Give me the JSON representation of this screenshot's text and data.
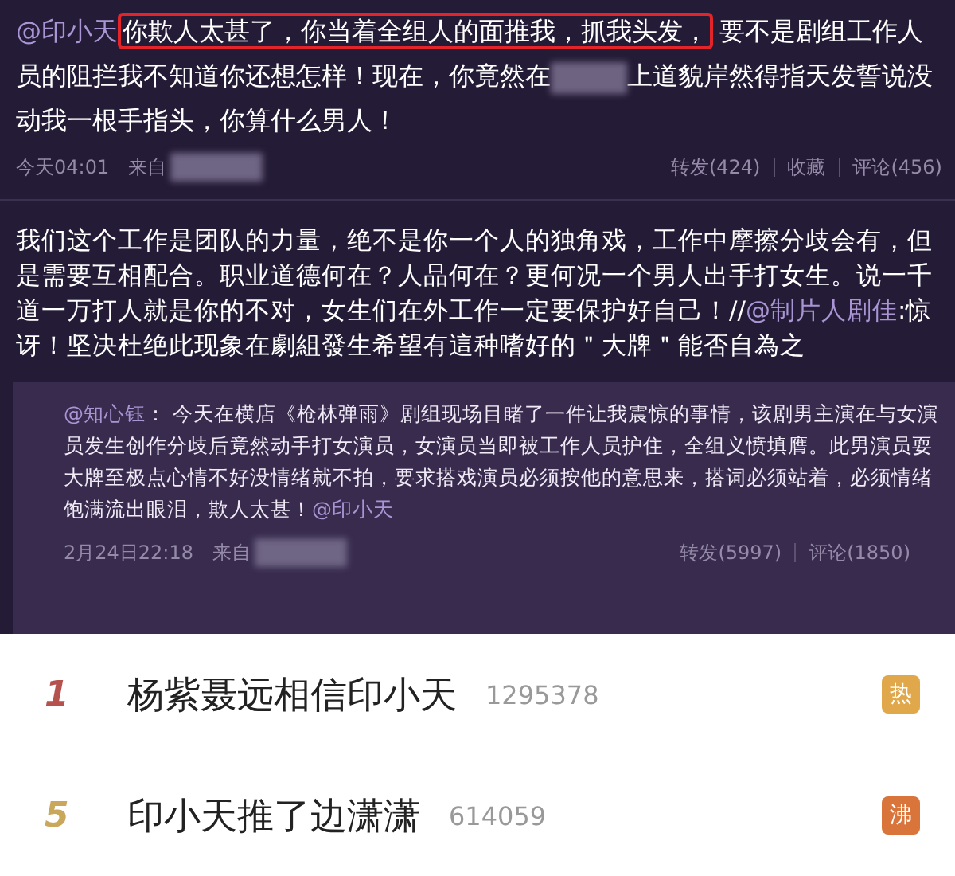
{
  "post": {
    "parts": [
      {
        "kind": "mention",
        "text": "@印小天"
      },
      {
        "kind": "highlight",
        "text": "你欺人太甚了，你当着全组人的面推我，抓我头发，"
      },
      {
        "kind": "text",
        "text": "要不是剧组工作人员的阻拦我不知道你还想怎样！现在，你竟然在"
      },
      {
        "kind": "redacted"
      },
      {
        "kind": "text",
        "text": "上道貌岸然得指天发誓说没动我一根手指头，你算什么男人！"
      }
    ],
    "time": "今天04:01",
    "source": "来自",
    "actions": [
      "转发(424)",
      "收藏",
      "评论(456)"
    ]
  },
  "repost": {
    "parts": [
      {
        "kind": "text",
        "text": "我们这个工作是团队的力量，绝不是你一个人的独角戏，工作中摩擦分歧会有，但是需要互相配合。职业道德何在？人品何在？更何况一个男人出手打女生。说一千道一万打人就是你的不对，女生们在外工作一定要保护好自己！//"
      },
      {
        "kind": "mention",
        "text": "@制片人剧佳"
      },
      {
        "kind": "text",
        "text": ":惊讶！坚决杜绝此现象在劇組發生希望有這种嗜好的＂大牌＂能否自為之"
      }
    ],
    "quote": {
      "parts": [
        {
          "kind": "mention",
          "text": "@知心钰"
        },
        {
          "kind": "text",
          "text": "： 今天在横店《枪林弹雨》剧组现场目睹了一件让我震惊的事情，该剧男主演在与女演员发生创作分歧后竟然动手打女演员，女演员当即被工作人员护住，全组义愤填膺。此男演员耍大牌至极点心情不好没情绪就不拍，要求搭戏演员必须按他的意思来，搭词必须站着，必须情绪饱满流出眼泪，欺人太甚！"
        },
        {
          "kind": "mention",
          "text": "@印小天"
        }
      ],
      "time": "2月24日22:18",
      "source": "来自",
      "actions": [
        "转发(5997)",
        "评论(1850)"
      ]
    }
  },
  "hot_list": [
    {
      "rank": {
        "text": "1",
        "color": "#b5524e"
      },
      "title": "杨紫聂远相信印小天",
      "count": "1295378",
      "badge": {
        "text": "热",
        "color": "#e0a84a"
      }
    },
    {
      "rank": {
        "text": "5",
        "color": "#c9a85c"
      },
      "title": "印小天推了边潇潇",
      "count": "614059",
      "badge": {
        "text": "沸",
        "color": "#d9743a"
      }
    }
  ]
}
